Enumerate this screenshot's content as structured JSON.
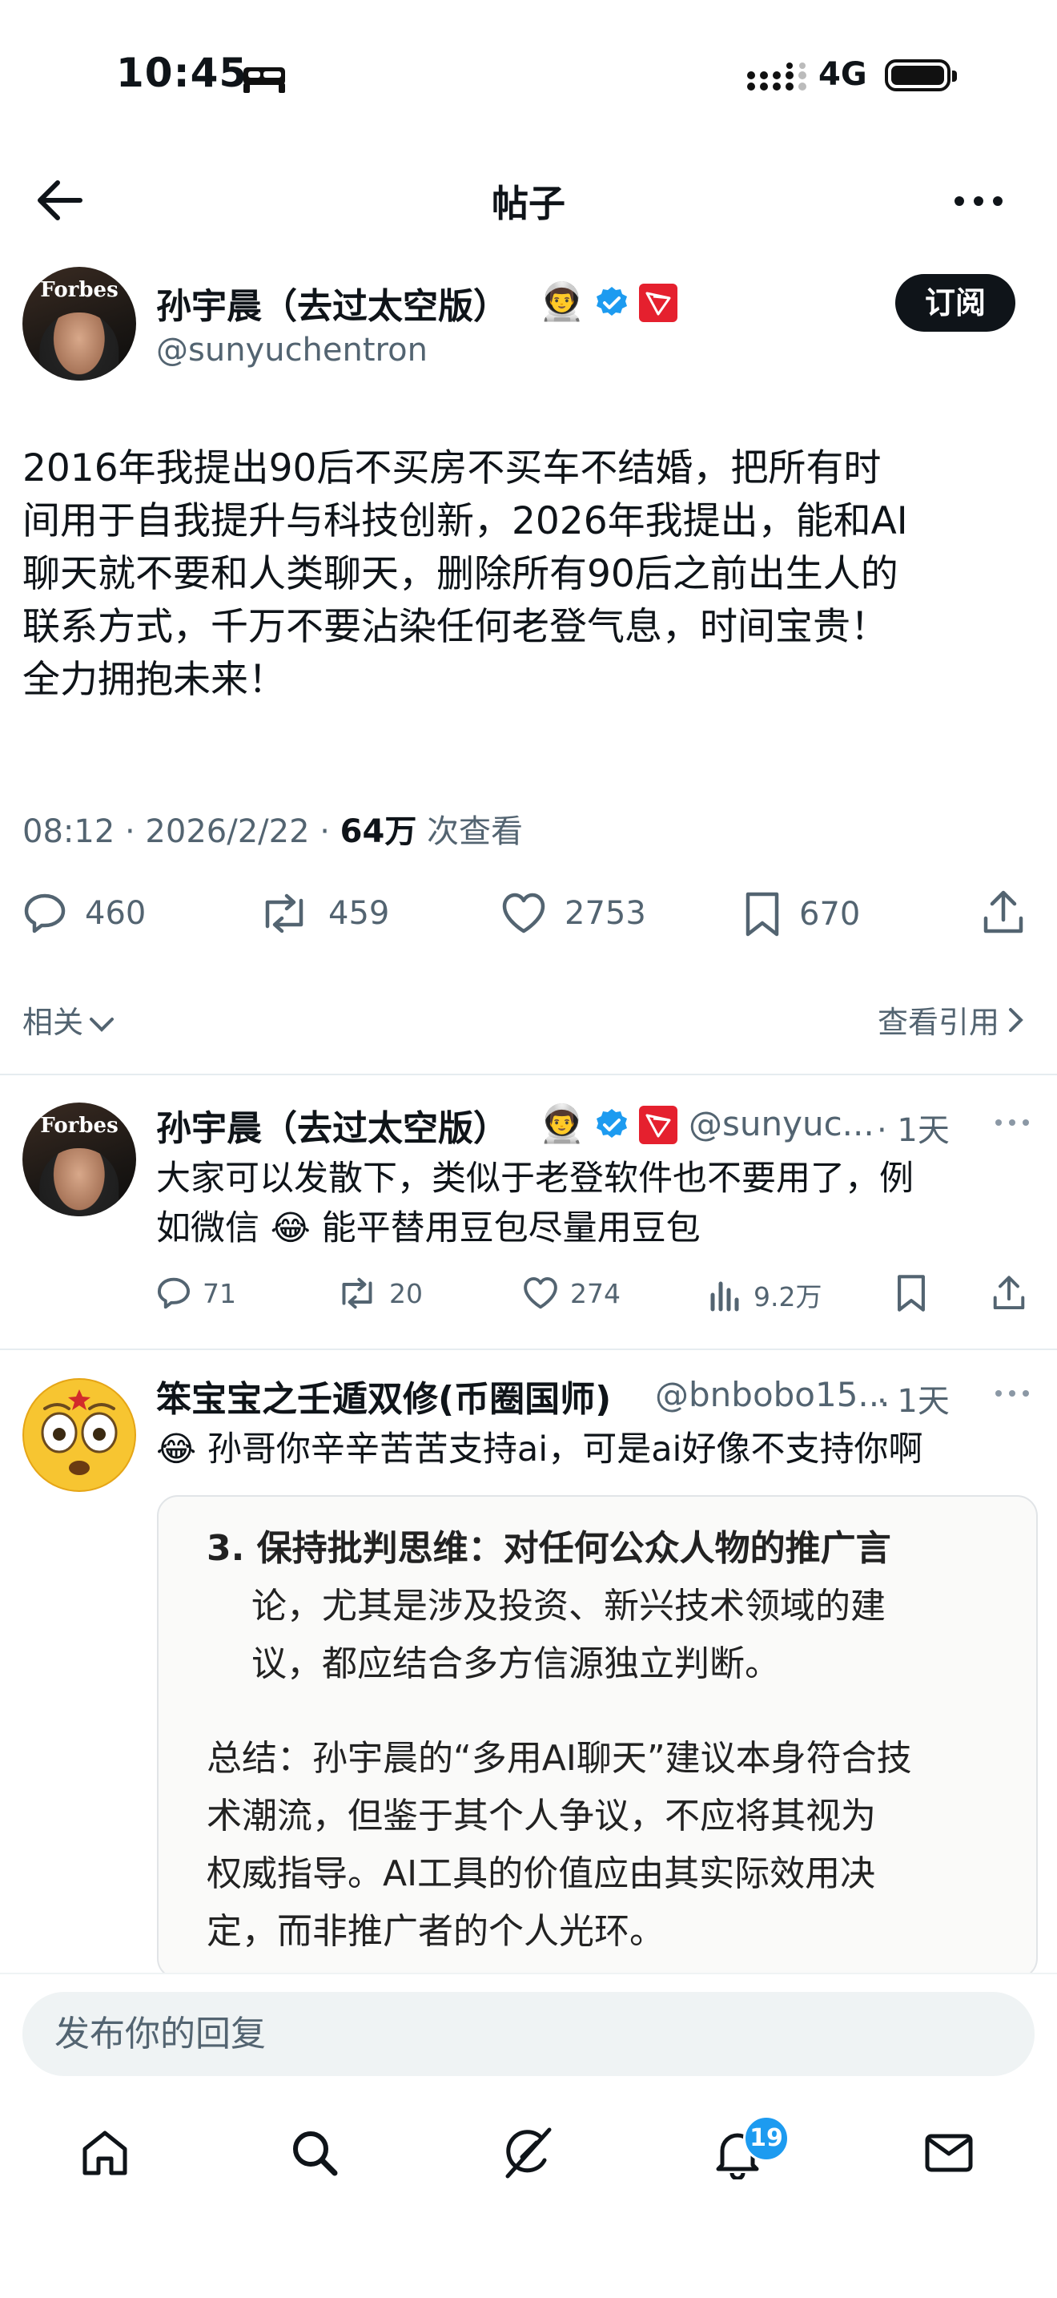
{
  "status_bar": {
    "time": "10:45",
    "network": "4G"
  },
  "header": {
    "title": "帖子"
  },
  "post": {
    "author_name": "孙宇晨（去过太空版）",
    "handle": "@sunyuchentron",
    "avatar_brand": "Forbes",
    "subscribe_label": "订阅",
    "text_lines": [
      "2016年我提出90后不买房不买车不结婚，把所有时",
      "间用于自我提升与科技创新，2026年我提出，能和AI",
      "聊天就不要和人类聊天，删除所有90后之前出生人的",
      "联系方式，千万不要沾染任何老登气息，时间宝贵！",
      "全力拥抱未来！"
    ],
    "timestamp": "08:12 · 2026/2/22 · ",
    "views_count": "64万",
    "views_label": " 次查看",
    "replies": "460",
    "reposts": "459",
    "likes": "2753",
    "bookmarks": "670"
  },
  "related_label": "相关",
  "quotes_label": "查看引用",
  "reply1": {
    "author_name": "孙宇晨（去过太空版）",
    "handle": "@sunyuc...",
    "time": "· 1天",
    "avatar_brand": "Forbes",
    "line1": "大家可以发散下，类似于老登软件也不要用了，例",
    "line2": "如微信 😂 能平替用豆包尽量用豆包",
    "replies": "71",
    "reposts": "20",
    "likes": "274",
    "views": "9.2万"
  },
  "reply2": {
    "author_name": "笨宝宝之壬遁双修(币圈国师)",
    "handle": "@bnbobo15...",
    "time": "· 1天",
    "line1": "😂 孙哥你辛辛苦苦支持ai，可是ai好像不支持你啊",
    "quote_lines": [
      "3.  保持批判思维：对任何公众人物的推广言",
      "论，尤其是涉及投资、新兴技术领域的建",
      "议，都应结合多方信源独立判断。",
      "总结：孙宇晨的“多用AI聊天”建议本身符合技",
      "术潮流，但鉴于其个人争议，不应将其视为",
      "权威指导。AI工具的价值应由其实际效用决",
      "定，而非推广者的个人光环。"
    ]
  },
  "reply_placeholder": "发布你的回复",
  "tabs": {
    "notifications_badge": "19"
  },
  "colors": {
    "verified": "#1d9bf0",
    "tron": "#e5202e",
    "badge": "#1d9bf0"
  },
  "icons": [
    "bed-icon",
    "signal-icon",
    "battery-icon",
    "back-arrow-icon",
    "more-icon",
    "astronaut-emoji",
    "verified-badge-icon",
    "tron-icon",
    "reply-icon",
    "repost-icon",
    "like-icon",
    "bookmark-icon",
    "share-icon",
    "chevron-down-icon",
    "chevron-right-icon",
    "views-icon",
    "home-icon",
    "search-icon",
    "grok-icon",
    "bell-icon",
    "mail-icon"
  ]
}
